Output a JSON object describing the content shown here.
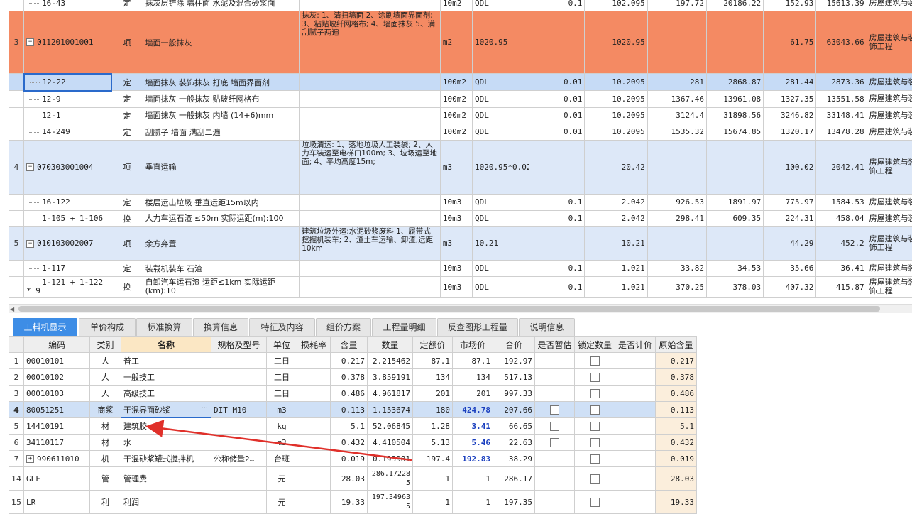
{
  "top_rows": [
    {
      "style": "plain",
      "num": "",
      "code": "16-43",
      "type": "定",
      "name": "抹灰层铲除 墙柱面 水泥及混合砂浆面",
      "feature": "",
      "unit": "10m2",
      "expr": "QDL",
      "coef": "0.1",
      "qty": "102.095",
      "price": "197.72",
      "total": "20186.22",
      "p2": "152.93",
      "t2": "15613.39",
      "spec": "房屋建筑与装",
      "level": 2
    },
    {
      "style": "orange",
      "num": "3",
      "code": "011201001001",
      "type": "项",
      "name": "墙面一般抹灰",
      "feature": "抹灰:\n1、清扫墙面\n2、涂刷墙面界面剂;\n3、粘贴玻纤网格布;\n4、墙面抹灰\n5、满刮腻子两遍",
      "unit": "m2",
      "expr": "1020.95",
      "coef": "",
      "qty": "1020.95",
      "price": "",
      "total": "",
      "p2": "61.75",
      "t2": "63043.66",
      "spec": "房屋建筑与装饰工程",
      "level": 1
    },
    {
      "style": "sel",
      "num": "",
      "code": "12-22",
      "type": "定",
      "name": "墙面抹灰 装饰抹灰 打底 墙面界面剂",
      "feature": "",
      "unit": "100m2",
      "expr": "QDL",
      "coef": "0.01",
      "qty": "10.2095",
      "price": "281",
      "total": "2868.87",
      "p2": "281.44",
      "t2": "2873.36",
      "spec": "房屋建筑与装",
      "level": 2
    },
    {
      "style": "plain",
      "num": "",
      "code": "12-9",
      "type": "定",
      "name": "墙面抹灰 一般抹灰 贴玻纤网格布",
      "feature": "",
      "unit": "100m2",
      "expr": "QDL",
      "coef": "0.01",
      "qty": "10.2095",
      "price": "1367.46",
      "total": "13961.08",
      "p2": "1327.35",
      "t2": "13551.58",
      "spec": "房屋建筑与装",
      "level": 2
    },
    {
      "style": "plain",
      "num": "",
      "code": "12-1",
      "type": "定",
      "name": "墙面抹灰 一般抹灰 内墙 (14+6)mm",
      "feature": "",
      "unit": "100m2",
      "expr": "QDL",
      "coef": "0.01",
      "qty": "10.2095",
      "price": "3124.4",
      "total": "31898.56",
      "p2": "3246.82",
      "t2": "33148.41",
      "spec": "房屋建筑与装",
      "level": 2
    },
    {
      "style": "plain",
      "num": "",
      "code": "14-249",
      "type": "定",
      "name": "刮腻子 墙面 满刮二遍",
      "feature": "",
      "unit": "100m2",
      "expr": "QDL",
      "coef": "0.01",
      "qty": "10.2095",
      "price": "1535.32",
      "total": "15674.85",
      "p2": "1320.17",
      "t2": "13478.28",
      "spec": "房屋建筑与装",
      "level": 2
    },
    {
      "style": "blue",
      "num": "4",
      "code": "070303001004",
      "type": "项",
      "name": "垂直运输",
      "feature": "垃圾清运:\n1、落地垃圾人工装袋;\n2、人力车装运至电梯口100m;\n3、垃圾运至地面;\n4、平均高度15m;",
      "unit": "m3",
      "expr": "1020.95*0.02",
      "coef": "",
      "qty": "20.42",
      "price": "",
      "total": "",
      "p2": "100.02",
      "t2": "2042.41",
      "spec": "房屋建筑与装饰工程",
      "level": 1
    },
    {
      "style": "plain",
      "num": "",
      "code": "16-122",
      "type": "定",
      "name": "楼层运出垃圾 垂直运距15m以内",
      "feature": "",
      "unit": "10m3",
      "expr": "QDL",
      "coef": "0.1",
      "qty": "2.042",
      "price": "926.53",
      "total": "1891.97",
      "p2": "775.97",
      "t2": "1584.53",
      "spec": "房屋建筑与装",
      "level": 2
    },
    {
      "style": "plain",
      "num": "",
      "code": "1-105 + 1-106",
      "type": "换",
      "name": "人力车运石渣 ≤50m  实际运距(m):100",
      "feature": "",
      "unit": "10m3",
      "expr": "QDL",
      "coef": "0.1",
      "qty": "2.042",
      "price": "298.41",
      "total": "609.35",
      "p2": "224.31",
      "t2": "458.04",
      "spec": "房屋建筑与装",
      "level": 2
    },
    {
      "style": "blue",
      "num": "5",
      "code": "010103002007",
      "type": "项",
      "name": "余方弃置",
      "feature": "建筑垃圾外运:水泥砂浆废料\n1、履带式挖掘机装车;\n2、渣土车运输、卸渣,运距10km",
      "unit": "m3",
      "expr": "10.21",
      "coef": "",
      "qty": "10.21",
      "price": "",
      "total": "",
      "p2": "44.29",
      "t2": "452.2",
      "spec": "房屋建筑与装饰工程",
      "level": 1
    },
    {
      "style": "plain",
      "num": "",
      "code": "1-117",
      "type": "定",
      "name": "装载机装车 石渣",
      "feature": "",
      "unit": "10m3",
      "expr": "QDL",
      "coef": "0.1",
      "qty": "1.021",
      "price": "33.82",
      "total": "34.53",
      "p2": "35.66",
      "t2": "36.41",
      "spec": "房屋建筑与装",
      "level": 2
    },
    {
      "style": "plain",
      "num": "",
      "code": "1-121 + 1-122 * 9",
      "type": "换",
      "name": "自卸汽车运石渣 运距≤1km  实际运距(km):10",
      "feature": "",
      "unit": "10m3",
      "expr": "QDL",
      "coef": "0.1",
      "qty": "1.021",
      "price": "370.25",
      "total": "378.03",
      "p2": "407.32",
      "t2": "415.87",
      "spec": "房屋建筑与装饰工程",
      "level": 2
    }
  ],
  "tabs": [
    "工料机显示",
    "单价构成",
    "标准换算",
    "换算信息",
    "特征及内容",
    "组价方案",
    "工程量明细",
    "反查图形工程量",
    "说明信息"
  ],
  "bottom_headers": [
    "",
    "编码",
    "类别",
    "名称",
    "规格及型号",
    "单位",
    "损耗率",
    "含量",
    "数量",
    "定额价",
    "市场价",
    "合价",
    "是否暂估",
    "锁定数量",
    "是否计价",
    "原始含量"
  ],
  "bottom_rows": [
    {
      "n": "1",
      "code": "00010101",
      "cat": "人",
      "name": "普工",
      "spec": "",
      "unit": "工日",
      "loss": "",
      "content": "0.217",
      "qty": "2.215462",
      "dprice": "87.1",
      "mprice": "87.1",
      "total": "192.97",
      "est": false,
      "lock": true,
      "orig": "0.217"
    },
    {
      "n": "2",
      "code": "00010102",
      "cat": "人",
      "name": "一般技工",
      "spec": "",
      "unit": "工日",
      "loss": "",
      "content": "0.378",
      "qty": "3.859191",
      "dprice": "134",
      "mprice": "134",
      "total": "517.13",
      "est": false,
      "lock": true,
      "orig": "0.378"
    },
    {
      "n": "3",
      "code": "00010103",
      "cat": "人",
      "name": "高级技工",
      "spec": "",
      "unit": "工日",
      "loss": "",
      "content": "0.486",
      "qty": "4.961817",
      "dprice": "201",
      "mprice": "201",
      "total": "997.33",
      "est": false,
      "lock": true,
      "orig": "0.486"
    },
    {
      "n": "4",
      "code": "80051251",
      "cat": "商浆",
      "name": "干混界面砂浆",
      "spec": "DIT M10",
      "unit": "m3",
      "loss": "",
      "content": "0.113",
      "qty": "1.153674",
      "dprice": "180",
      "mprice": "424.78",
      "total": "207.66",
      "est": true,
      "lock": true,
      "orig": "0.113",
      "sel": true,
      "bold": true
    },
    {
      "n": "5",
      "code": "14410191",
      "cat": "材",
      "name": "建筑胶",
      "spec": "",
      "unit": "kg",
      "loss": "",
      "content": "5.1",
      "qty": "52.06845",
      "dprice": "1.28",
      "mprice": "3.41",
      "total": "66.65",
      "est": true,
      "lock": true,
      "orig": "5.1",
      "bold": true
    },
    {
      "n": "6",
      "code": "34110117",
      "cat": "材",
      "name": "水",
      "spec": "",
      "unit": "m3",
      "loss": "",
      "content": "0.432",
      "qty": "4.410504",
      "dprice": "5.13",
      "mprice": "5.46",
      "total": "22.63",
      "est": true,
      "lock": true,
      "orig": "0.432",
      "bold": true
    },
    {
      "n": "7",
      "code": "990611010",
      "cat": "机",
      "name": "干混砂浆罐式搅拌机",
      "spec": "公称储量2…",
      "unit": "台班",
      "loss": "",
      "content": "0.019",
      "qty": "0.193981",
      "dprice": "197.4",
      "mprice": "192.83",
      "total": "38.29",
      "est": false,
      "lock": true,
      "orig": "0.019",
      "bold": true,
      "plus": true
    },
    {
      "n": "14",
      "code": "GLF",
      "cat": "管",
      "name": "管理费",
      "spec": "",
      "unit": "元",
      "loss": "",
      "content": "28.03",
      "qty": "286.17228\n5",
      "dprice": "1",
      "mprice": "1",
      "total": "286.17",
      "est": false,
      "lock": true,
      "orig": "28.03",
      "tall": true
    },
    {
      "n": "15",
      "code": "LR",
      "cat": "利",
      "name": "利润",
      "spec": "",
      "unit": "元",
      "loss": "",
      "content": "19.33",
      "qty": "197.34963\n5",
      "dprice": "1",
      "mprice": "1",
      "total": "197.35",
      "est": false,
      "lock": true,
      "orig": "19.33",
      "tall": true
    }
  ],
  "colors": {
    "orange_row": "#f48a63",
    "blue_row": "#dde8f8",
    "selected": "#c6dbf6",
    "tab_active": "#3d8de6",
    "arrow": "#e0302a",
    "price_blue": "#1a3fbf"
  }
}
